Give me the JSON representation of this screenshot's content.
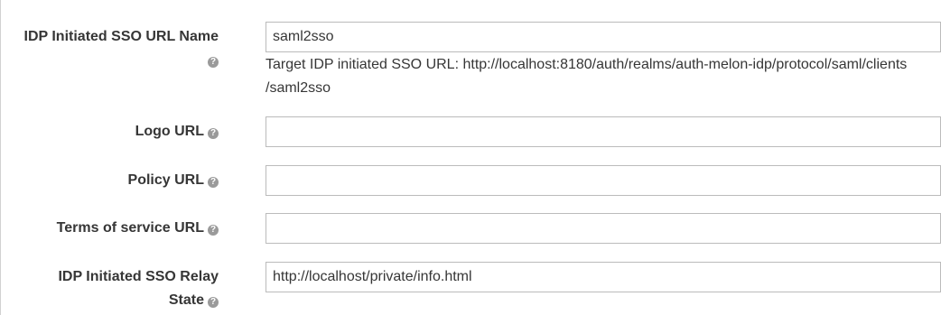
{
  "form": {
    "idp_sso_url_name": {
      "label": "IDP Initiated SSO URL Name",
      "help_icon": "?",
      "value": "saml2sso",
      "helptext_line1": "Target IDP initiated SSO URL: http://localhost:8180/auth/realms/auth-melon-idp/protocol/saml/clients",
      "helptext_line2": "/saml2sso"
    },
    "logo_url": {
      "label": "Logo URL",
      "help_icon": "?",
      "value": ""
    },
    "policy_url": {
      "label": "Policy URL",
      "help_icon": "?",
      "value": ""
    },
    "tos_url": {
      "label": "Terms of service URL",
      "help_icon": "?",
      "value": ""
    },
    "idp_relay_state": {
      "label_line1": "IDP Initiated SSO Relay",
      "label_line2": "State",
      "help_icon": "?",
      "value": "http://localhost/private/info.html"
    }
  }
}
